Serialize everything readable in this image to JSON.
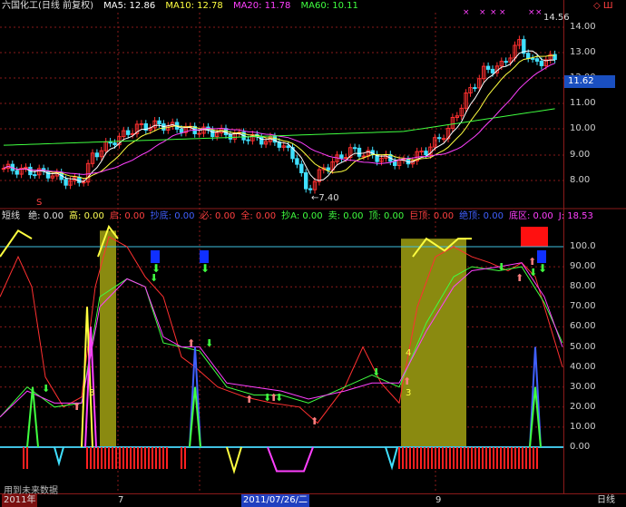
{
  "header": {
    "title": "六国化工(日线 前复权)",
    "ma5": "MA5: 12.86",
    "ma10": "MA10: 12.78",
    "ma20": "MA20: 11.78",
    "ma60": "MA60: 10.11",
    "corner": "◇ Ш"
  },
  "price_axis": [
    "14.00",
    "13.00",
    "12.00",
    "11.00",
    "10.00",
    "9.00",
    "8.00"
  ],
  "price_box": "11.62",
  "high_label": "14.56",
  "low_label": "←7.40",
  "low_marker": "S",
  "indicator": {
    "name": "短线",
    "fields": [
      {
        "label": "绝: 0.00",
        "color": "#e0e0e0"
      },
      {
        "label": "高: 0.00",
        "color": "#ffff55"
      },
      {
        "label": "启: 0.00",
        "color": "#ff4040"
      },
      {
        "label": "抄底: 0.00",
        "color": "#4060ff"
      },
      {
        "label": "必: 0.00",
        "color": "#ff4040"
      },
      {
        "label": "全: 0.00",
        "color": "#ff4040"
      },
      {
        "label": "抄A: 0.00",
        "color": "#40ff40"
      },
      {
        "label": "卖: 0.00",
        "color": "#40ff40"
      },
      {
        "label": "顶: 0.00",
        "color": "#40ff40"
      },
      {
        "label": "巨顶: 0.00",
        "color": "#ff4040"
      },
      {
        "label": "绝顶: 0.00",
        "color": "#4060ff"
      },
      {
        "label": "底区: 0.00",
        "color": "#ff40ff"
      },
      {
        "label": "J: 18.53",
        "color": "#ff40ff"
      }
    ]
  },
  "indicator_axis": [
    "100.0",
    "90.00",
    "80.00",
    "70.00",
    "60.00",
    "50.00",
    "40.00",
    "30.00",
    "20.00",
    "10.00",
    "0.00"
  ],
  "labels_3_4": [
    "3",
    "3",
    "4"
  ],
  "bottom": {
    "year": "2011年",
    "m7": "7",
    "date_box": "2011/07/26/二",
    "m9": "9",
    "period": "日线",
    "footer": "用到未来数据"
  },
  "colors": {
    "up": "#ff3030",
    "down": "#40e0ff",
    "ma5": "#ffffff",
    "ma10": "#ffff40",
    "ma20": "#ff40ff",
    "ma60": "#40ff40",
    "grid": "#8a1a1a"
  }
}
